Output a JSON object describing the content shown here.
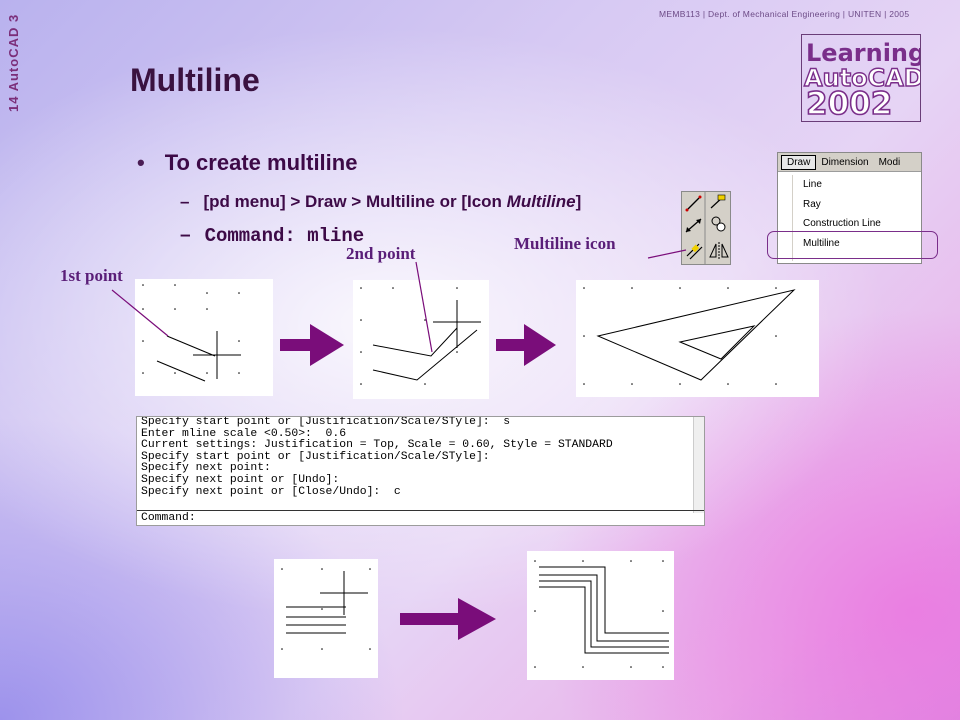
{
  "header": {
    "course_text": "MEMB113 | Dept. of Mechanical Engineering | UNITEN | 2005"
  },
  "side_label": "14 AutoCAD 3",
  "logo": {
    "line1": "Learning",
    "line2": "AutoCAD",
    "line3": "2002"
  },
  "slide": {
    "title": "Multiline",
    "bullet": "To create multiline",
    "sub1_prefix": "[pd menu] > Draw > Multiline  or [Icon ",
    "sub1_italic": "Multiline",
    "sub1_suffix": "]",
    "sub2": "Command: mline",
    "dash": "–"
  },
  "labels": {
    "first_point": "1st  point",
    "second_point": "2nd point",
    "multiline_icon": "Multiline icon"
  },
  "menu": {
    "bar_items": [
      "Draw",
      "Dimension",
      "Modi"
    ],
    "items": [
      "Line",
      "Ray",
      "Construction Line",
      "Multiline"
    ]
  },
  "command_window": {
    "lines": [
      "Specify start point or [Justification/Scale/STyle]:  s",
      "Enter mline scale <0.50>:  0.6",
      "Current settings: Justification = Top, Scale = 0.60, Style = STANDARD",
      "Specify start point or [Justification/Scale/STyle]:",
      "Specify next point:",
      "Specify next point or [Undo]:",
      "Specify next point or [Close/Undo]:  c"
    ],
    "prompt": "Command:"
  },
  "colors": {
    "arrow": "#7a0d7a",
    "title": "#3a1240",
    "text": "#3d0a47"
  }
}
